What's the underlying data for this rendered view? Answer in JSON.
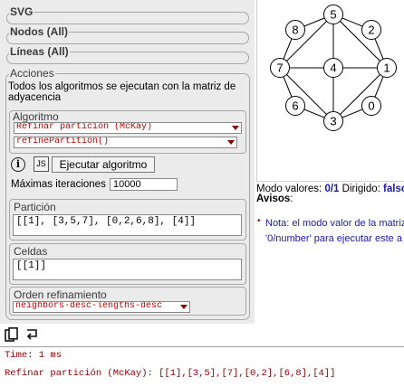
{
  "sections": {
    "svg": "SVG",
    "nodes": "Nodos (All)",
    "lines": "Líneas (All)",
    "actions": "Acciones"
  },
  "actions": {
    "note": "Todos los algoritmos se ejecutan con la matriz de adyacencia",
    "algorithm_legend": "Algoritmo",
    "algorithm_selected": "Refinar partición (McKay)",
    "method_selected": "refinePartition()",
    "info_icon": "i",
    "js_icon": "JS",
    "run_button": "Ejecutar algoritmo",
    "max_iter_label": "Máximas iteraciones",
    "max_iter_value": "10000",
    "partition_legend": "Partición",
    "partition_value": "[[1], [3,5,7], [0,2,6,8], [4]]",
    "cells_legend": "Celdas",
    "cells_value": "[[1]]",
    "order_legend": "Orden refinamiento",
    "order_selected": "neighbors-desc-lengths-desc"
  },
  "graph": {
    "nodes": [
      "5",
      "2",
      "8",
      "7",
      "4",
      "1",
      "6",
      "3",
      "0"
    ]
  },
  "status": {
    "mode_label": "Modo valores:",
    "mode_value": "0/1",
    "directed_label": "Dirigido:",
    "directed_value": "falso",
    "warnings_label": "Avisos",
    "colon": ":",
    "bullet": "•",
    "note_line1": "Nota: el modo valor de la matriz",
    "note_line2": "'0/number' para ejecutar este a"
  },
  "output": {
    "time": "Time: 1 ms",
    "result": "Refinar partición (McKay): [[1],[3,5],[7],[0,2],[6,8],[4]]"
  },
  "colors": {
    "panel_bg": "#ebebeb",
    "accent_red": "#c00000",
    "mode_blue": "#1a1aa6"
  }
}
